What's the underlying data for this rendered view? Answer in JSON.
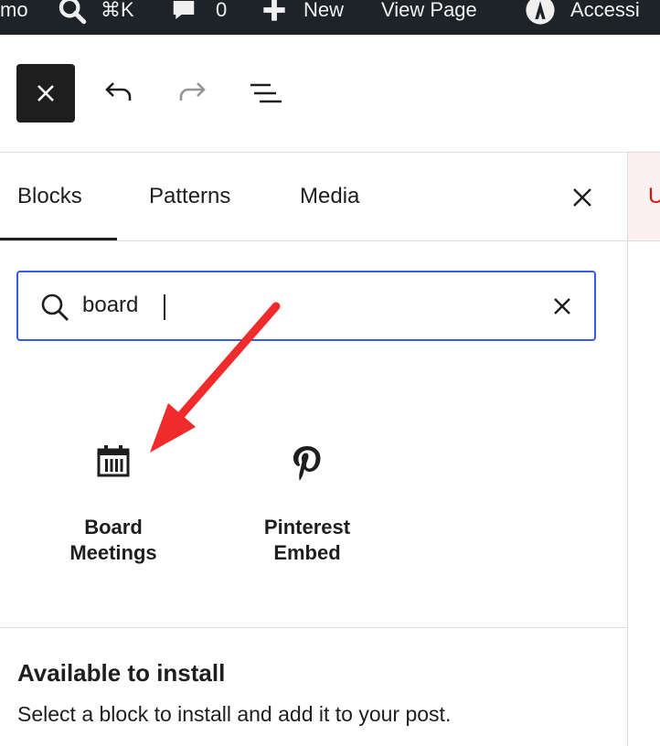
{
  "admin_bar": {
    "site_name": "mo",
    "search_shortcut": "⌘K",
    "comments_count": "0",
    "new_label": "New",
    "view_page_label": "View Page",
    "accessibility_label": "Accessi"
  },
  "toolbar": {
    "close_icon": "close-icon",
    "undo_icon": "undo-icon",
    "redo_icon": "redo-icon",
    "list_view_icon": "list-view-icon"
  },
  "inserter": {
    "tabs": [
      {
        "label": "Blocks",
        "active": true
      },
      {
        "label": "Patterns",
        "active": false
      },
      {
        "label": "Media",
        "active": false
      }
    ],
    "search": {
      "value": "board",
      "placeholder": "Search"
    },
    "results": [
      {
        "label_line1": "Board",
        "label_line2": "Meetings",
        "icon": "calendar-icon"
      },
      {
        "label_line1": "Pinterest",
        "label_line2": "Embed",
        "icon": "pinterest-icon"
      }
    ],
    "install_section": {
      "title": "Available to install",
      "description": "Select a block to install and add it to your post."
    }
  },
  "canvas_peek": {
    "letter": "U"
  },
  "colors": {
    "admin_bar_bg": "#1d2327",
    "focus_blue": "#3858e9",
    "annotation_red": "#ef2b2b"
  }
}
